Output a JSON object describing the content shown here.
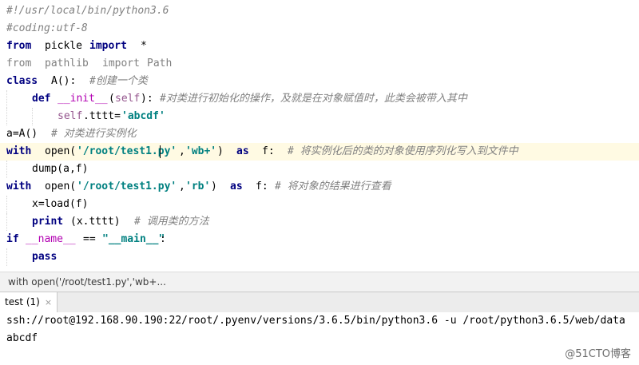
{
  "editor": {
    "lines": {
      "shebang": "#!/usr/local/bin/python3.6",
      "coding": "#coding:utf-8",
      "import1": {
        "from": "from",
        "module": "pickle",
        "import": "import",
        "what": "*"
      },
      "import2": {
        "from": "from",
        "module": "pathlib",
        "import": "import",
        "what": "Path"
      },
      "classdef": {
        "kw": "class",
        "name": "A():",
        "comment": "#创建一个类"
      },
      "initdef": {
        "kw": "def",
        "name": "__init__",
        "args_open": "(",
        "self": "self",
        "args_close": "):",
        "comment": "#对类进行初始化的操作，及就是在对象赋值时，此类会被带入其中"
      },
      "assign": {
        "self": "self",
        "attr": ".tttt=",
        "value": "'abcdf'"
      },
      "instance": {
        "code": "a=A()",
        "comment": "# 对类进行实例化"
      },
      "with1": {
        "kw": "with",
        "open": "open(",
        "path": "'/root/test1.py'",
        "comma": ",",
        "mode": "'wb+'",
        "close": ")",
        "as": "as",
        "var": "f:",
        "comment": "# 将实例化后的类的对象使用序列化写入到文件中"
      },
      "dump": "dump(a,f)",
      "with2": {
        "kw": "with",
        "open": "open(",
        "path": "'/root/test1.py'",
        "comma": ",",
        "mode": "'rb'",
        "close": ")",
        "as": "as",
        "var": "f:",
        "comment": "# 将对象的结果进行查看"
      },
      "load": "x=load(f)",
      "print": {
        "kw": "print",
        "args": "(x.tttt)",
        "comment": "# 调用类的方法"
      },
      "ifmain": {
        "kw": "if",
        "name": "__name__",
        "op": "==",
        "value": "\"__main__\"",
        "colon": ":"
      },
      "pass": "pass"
    }
  },
  "breadcrumb": "with open('/root/test1.py','wb+...",
  "run": {
    "tab_label": "test (1)",
    "close_glyph": "×"
  },
  "console": {
    "command": "ssh://root@192.168.90.190:22/root/.pyenv/versions/3.6.5/bin/python3.6 -u /root/python3.6.5/web/data",
    "output": "abcdf"
  },
  "watermark": "@51CTO博客"
}
